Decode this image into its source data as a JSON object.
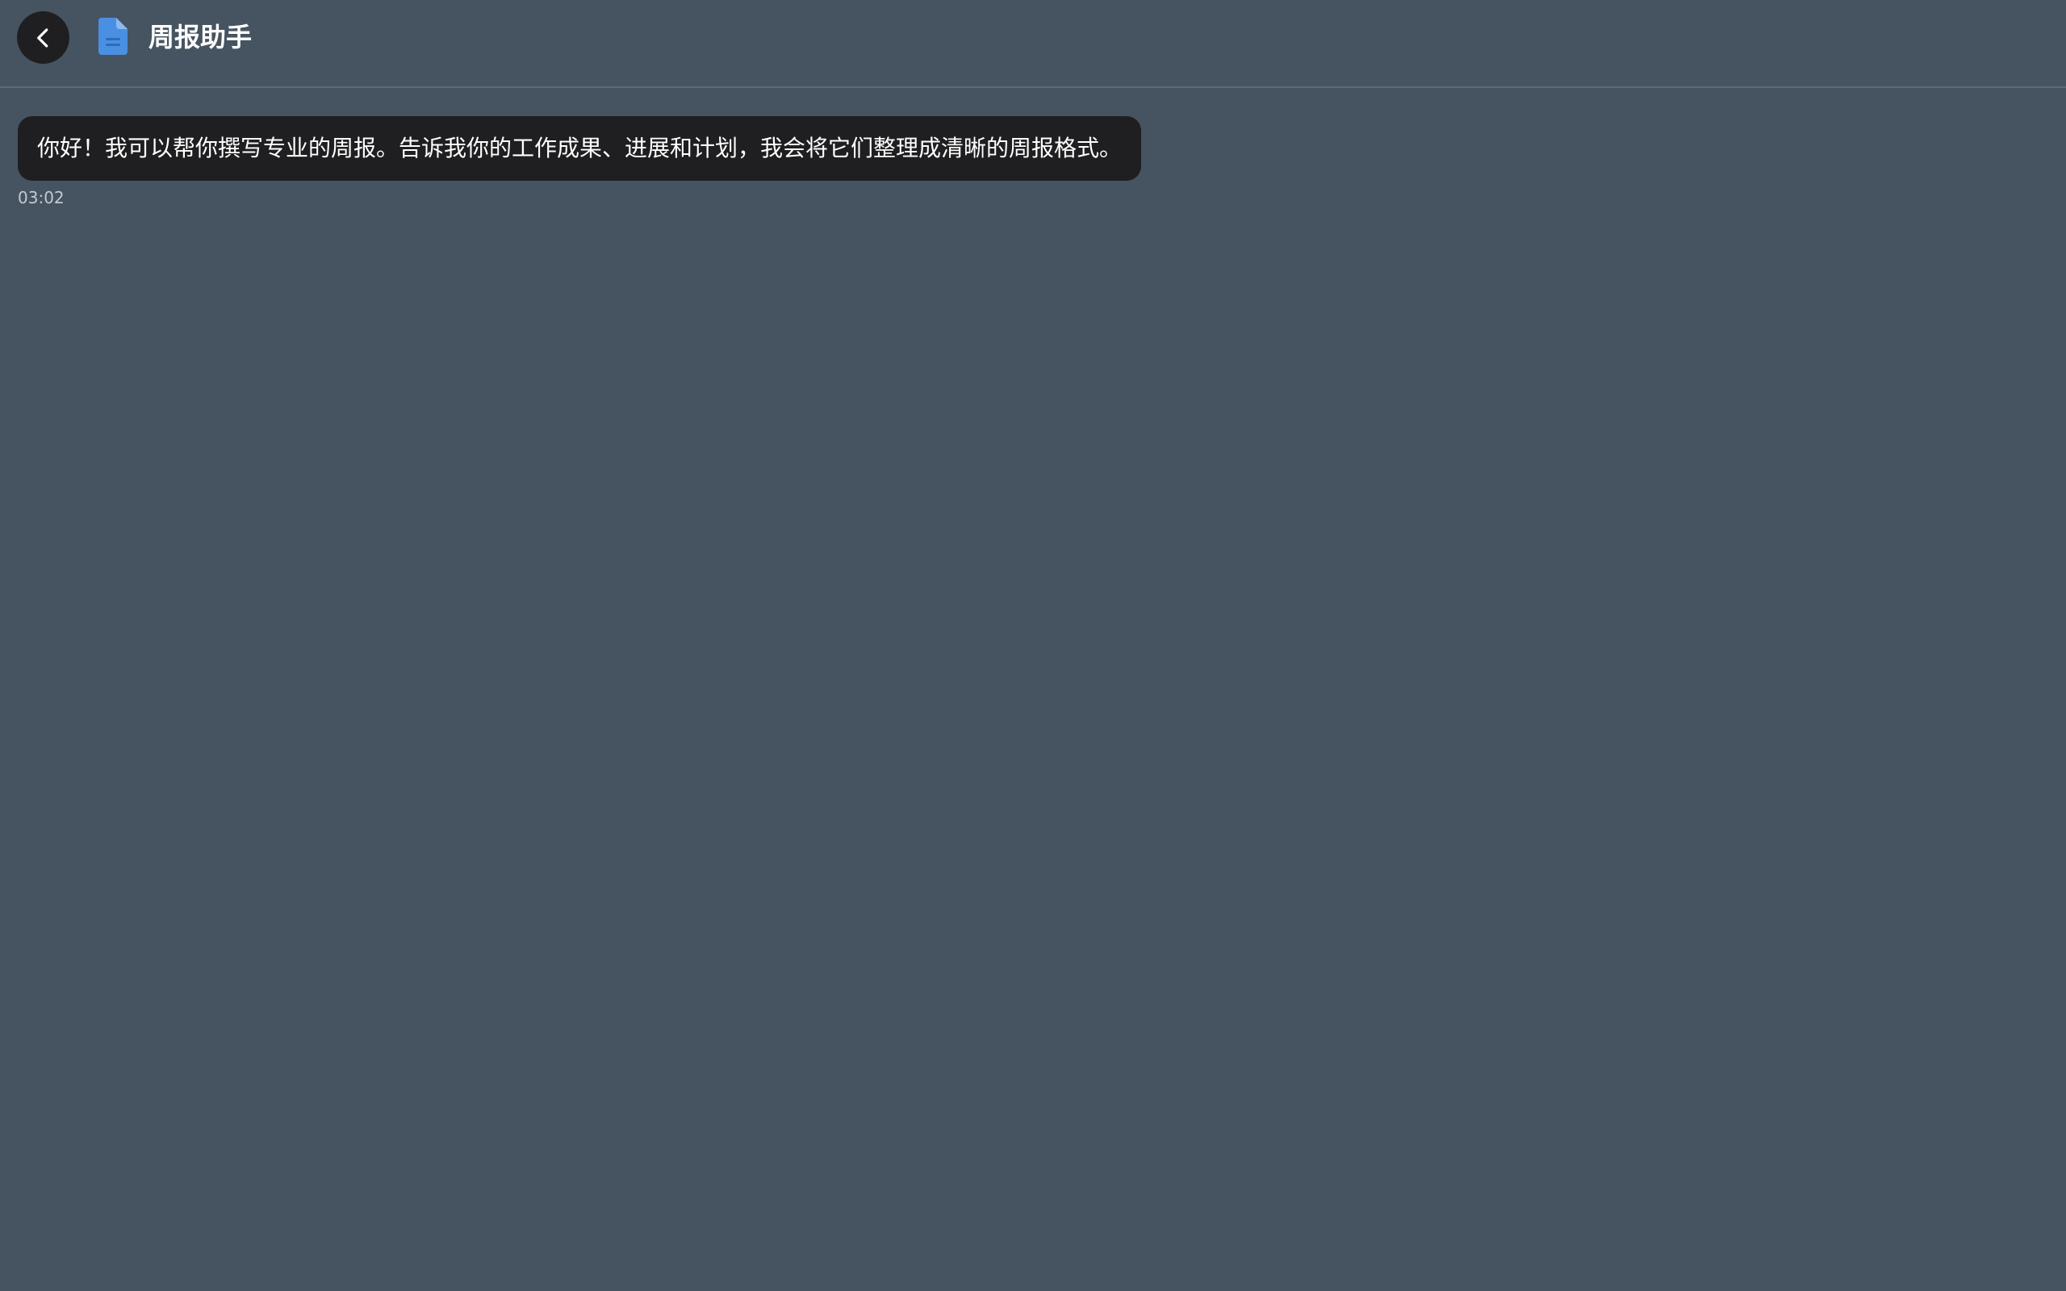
{
  "header": {
    "title": "周报助手",
    "back_icon": "chevron-left-icon",
    "doc_icon": "document-icon",
    "doc_icon_color": "#4a90e2"
  },
  "messages": [
    {
      "sender": "assistant",
      "text": "你好！我可以帮你撰写专业的周报。告诉我你的工作成果、进展和计划，我会将它们整理成清晰的周报格式。",
      "time": "03:02"
    }
  ],
  "colors": {
    "background": "#465461",
    "bubble": "#1f1f21",
    "divider": "#5e6b77"
  }
}
